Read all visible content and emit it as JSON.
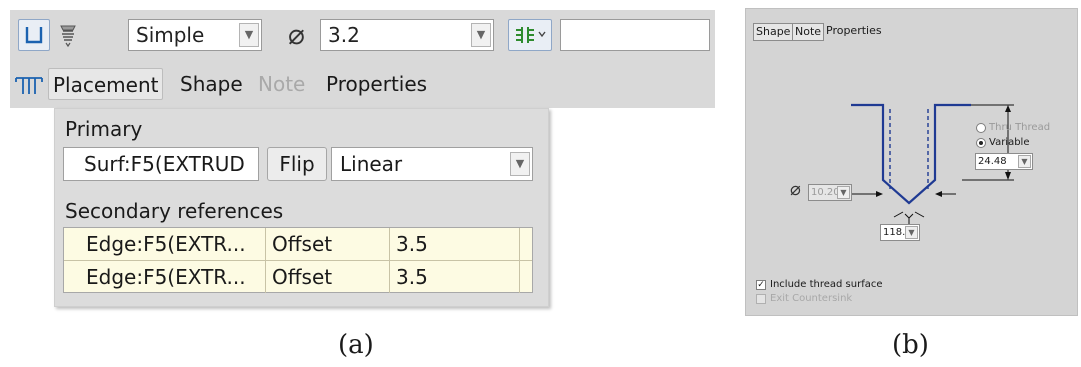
{
  "panel_a": {
    "toolbar": {
      "hole_type_combo": "Simple",
      "diameter_symbol": "⌀",
      "diameter_value": "3.2",
      "depth_value": ""
    },
    "tabs": [
      {
        "label": "Placement",
        "state": "active"
      },
      {
        "label": "Shape",
        "state": "normal"
      },
      {
        "label": "Note",
        "state": "disabled"
      },
      {
        "label": "Properties",
        "state": "normal"
      }
    ],
    "placement": {
      "primary_label": "Primary",
      "primary_reference": "Surf:F5(EXTRUD",
      "flip_label": "Flip",
      "placement_type": "Linear",
      "secondary_label": "Secondary references",
      "secondary_refs": [
        {
          "reference": "Edge:F5(EXTR...",
          "type": "Offset",
          "value": "3.5"
        },
        {
          "reference": "Edge:F5(EXTR...",
          "type": "Offset",
          "value": "3.5"
        }
      ]
    },
    "caption": "(a)"
  },
  "panel_b": {
    "tabs": {
      "shape": "Shape",
      "note": "Note",
      "properties": "Properties"
    },
    "diameter_symbol": "⌀",
    "diameter_value": "10.20",
    "angle_value": "118.00",
    "depth_value": "24.48",
    "thru_thread_label": "Thru Thread",
    "variable_label": "Variable",
    "include_thread_label": "Include thread surface",
    "exit_countersink_label": "Exit Countersink",
    "caption": "(b)"
  },
  "colors": {
    "toolbar_bg": "#d9d9d9",
    "refs_table_bg": "#fdfbe3",
    "hole_outline": "#1f3a93",
    "button_border": "#8fa7c7"
  }
}
